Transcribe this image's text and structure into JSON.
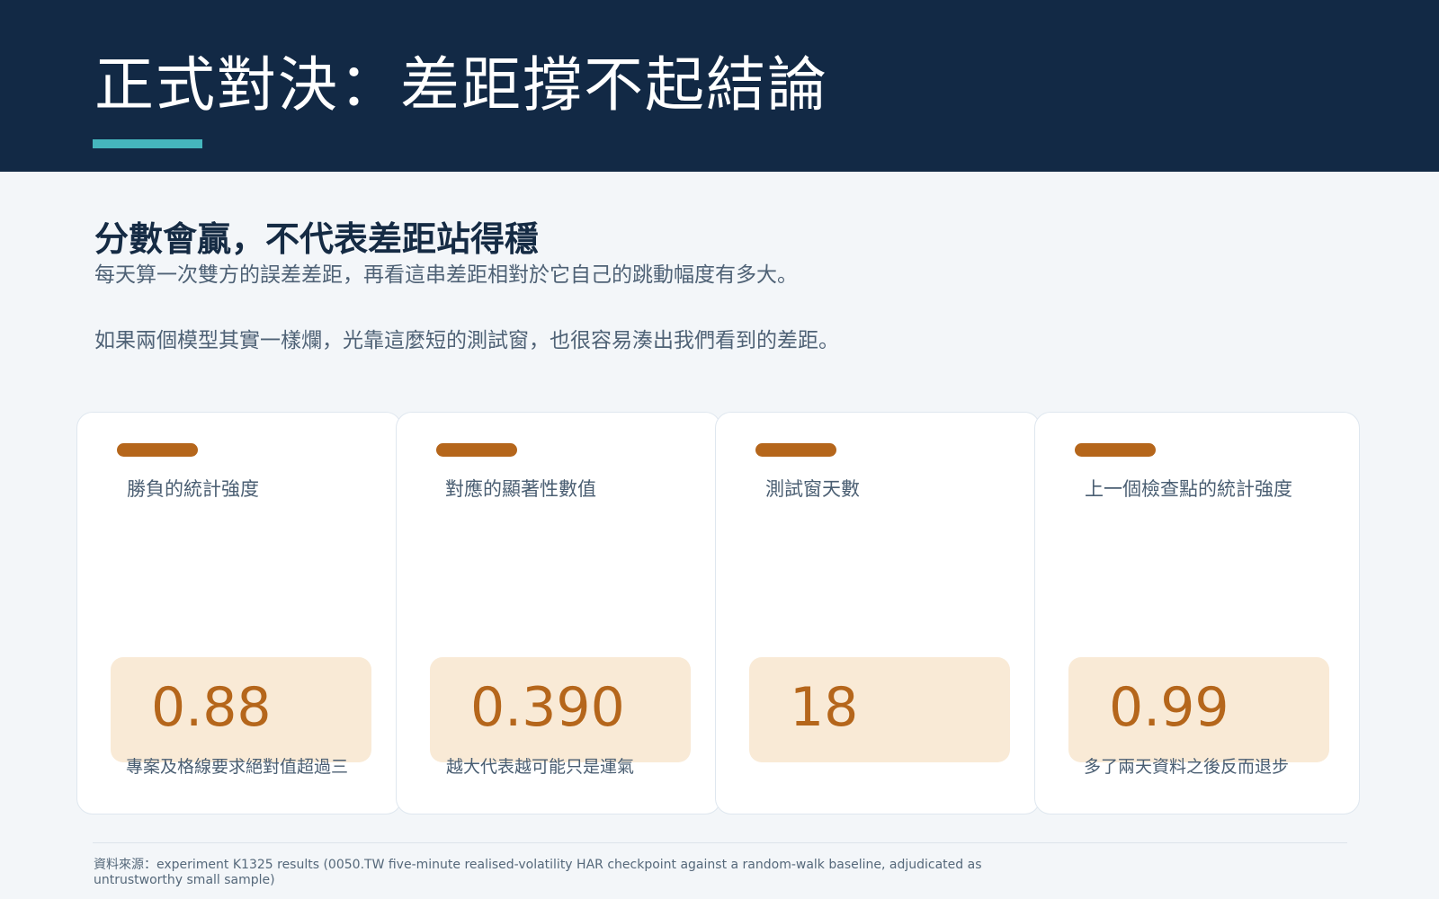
{
  "header": {
    "title": "正式對決：差距撐不起結論"
  },
  "intro": {
    "heading": "分數會贏，不代表差距站得穩",
    "line1": "每天算一次雙方的誤差差距，再看這串差距相對於它自己的跳動幅度有多大。",
    "line2": "如果兩個模型其實一樣爛，光靠這麼短的測試窗，也很容易湊出我們看到的差距。"
  },
  "cards": [
    {
      "label": "勝負的統計強度",
      "value": "0.88",
      "note": "專案及格線要求絕對值超過三"
    },
    {
      "label": "對應的顯著性數值",
      "value": "0.390",
      "note": "越大代表越可能只是運氣"
    },
    {
      "label": "測試窗天數",
      "value": "18",
      "note": ""
    },
    {
      "label": "上一個檢查點的統計強度",
      "value": "0.99",
      "note": "多了兩天資料之後反而退步"
    }
  ],
  "footer": {
    "source": "資料來源：experiment K1325 results (0050.TW five-minute realised-volatility HAR checkpoint against a random-walk baseline, adjudicated as untrustworthy small sample)"
  },
  "colors": {
    "header_bg": "#122945",
    "accent": "#45b6bd",
    "card_accent": "#b5661b",
    "value_box": "#f9ead6"
  }
}
